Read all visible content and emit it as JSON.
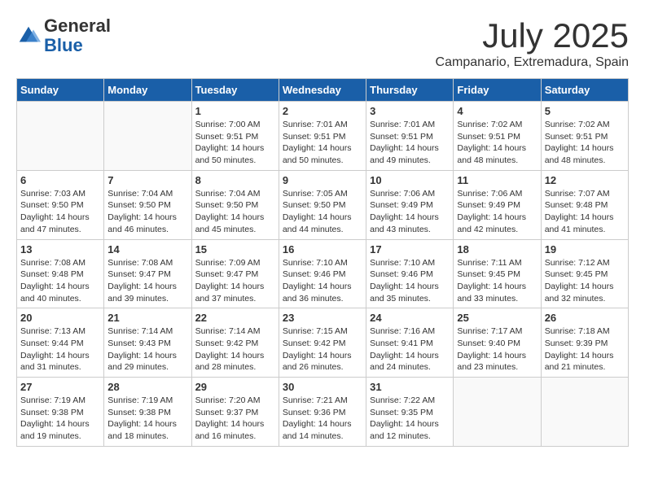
{
  "logo": {
    "general": "General",
    "blue": "Blue"
  },
  "header": {
    "month": "July 2025",
    "location": "Campanario, Extremadura, Spain"
  },
  "days_of_week": [
    "Sunday",
    "Monday",
    "Tuesday",
    "Wednesday",
    "Thursday",
    "Friday",
    "Saturday"
  ],
  "weeks": [
    [
      {
        "day": "",
        "info": ""
      },
      {
        "day": "",
        "info": ""
      },
      {
        "day": "1",
        "info": "Sunrise: 7:00 AM\nSunset: 9:51 PM\nDaylight: 14 hours and 50 minutes."
      },
      {
        "day": "2",
        "info": "Sunrise: 7:01 AM\nSunset: 9:51 PM\nDaylight: 14 hours and 50 minutes."
      },
      {
        "day": "3",
        "info": "Sunrise: 7:01 AM\nSunset: 9:51 PM\nDaylight: 14 hours and 49 minutes."
      },
      {
        "day": "4",
        "info": "Sunrise: 7:02 AM\nSunset: 9:51 PM\nDaylight: 14 hours and 48 minutes."
      },
      {
        "day": "5",
        "info": "Sunrise: 7:02 AM\nSunset: 9:51 PM\nDaylight: 14 hours and 48 minutes."
      }
    ],
    [
      {
        "day": "6",
        "info": "Sunrise: 7:03 AM\nSunset: 9:50 PM\nDaylight: 14 hours and 47 minutes."
      },
      {
        "day": "7",
        "info": "Sunrise: 7:04 AM\nSunset: 9:50 PM\nDaylight: 14 hours and 46 minutes."
      },
      {
        "day": "8",
        "info": "Sunrise: 7:04 AM\nSunset: 9:50 PM\nDaylight: 14 hours and 45 minutes."
      },
      {
        "day": "9",
        "info": "Sunrise: 7:05 AM\nSunset: 9:50 PM\nDaylight: 14 hours and 44 minutes."
      },
      {
        "day": "10",
        "info": "Sunrise: 7:06 AM\nSunset: 9:49 PM\nDaylight: 14 hours and 43 minutes."
      },
      {
        "day": "11",
        "info": "Sunrise: 7:06 AM\nSunset: 9:49 PM\nDaylight: 14 hours and 42 minutes."
      },
      {
        "day": "12",
        "info": "Sunrise: 7:07 AM\nSunset: 9:48 PM\nDaylight: 14 hours and 41 minutes."
      }
    ],
    [
      {
        "day": "13",
        "info": "Sunrise: 7:08 AM\nSunset: 9:48 PM\nDaylight: 14 hours and 40 minutes."
      },
      {
        "day": "14",
        "info": "Sunrise: 7:08 AM\nSunset: 9:47 PM\nDaylight: 14 hours and 39 minutes."
      },
      {
        "day": "15",
        "info": "Sunrise: 7:09 AM\nSunset: 9:47 PM\nDaylight: 14 hours and 37 minutes."
      },
      {
        "day": "16",
        "info": "Sunrise: 7:10 AM\nSunset: 9:46 PM\nDaylight: 14 hours and 36 minutes."
      },
      {
        "day": "17",
        "info": "Sunrise: 7:10 AM\nSunset: 9:46 PM\nDaylight: 14 hours and 35 minutes."
      },
      {
        "day": "18",
        "info": "Sunrise: 7:11 AM\nSunset: 9:45 PM\nDaylight: 14 hours and 33 minutes."
      },
      {
        "day": "19",
        "info": "Sunrise: 7:12 AM\nSunset: 9:45 PM\nDaylight: 14 hours and 32 minutes."
      }
    ],
    [
      {
        "day": "20",
        "info": "Sunrise: 7:13 AM\nSunset: 9:44 PM\nDaylight: 14 hours and 31 minutes."
      },
      {
        "day": "21",
        "info": "Sunrise: 7:14 AM\nSunset: 9:43 PM\nDaylight: 14 hours and 29 minutes."
      },
      {
        "day": "22",
        "info": "Sunrise: 7:14 AM\nSunset: 9:42 PM\nDaylight: 14 hours and 28 minutes."
      },
      {
        "day": "23",
        "info": "Sunrise: 7:15 AM\nSunset: 9:42 PM\nDaylight: 14 hours and 26 minutes."
      },
      {
        "day": "24",
        "info": "Sunrise: 7:16 AM\nSunset: 9:41 PM\nDaylight: 14 hours and 24 minutes."
      },
      {
        "day": "25",
        "info": "Sunrise: 7:17 AM\nSunset: 9:40 PM\nDaylight: 14 hours and 23 minutes."
      },
      {
        "day": "26",
        "info": "Sunrise: 7:18 AM\nSunset: 9:39 PM\nDaylight: 14 hours and 21 minutes."
      }
    ],
    [
      {
        "day": "27",
        "info": "Sunrise: 7:19 AM\nSunset: 9:38 PM\nDaylight: 14 hours and 19 minutes."
      },
      {
        "day": "28",
        "info": "Sunrise: 7:19 AM\nSunset: 9:38 PM\nDaylight: 14 hours and 18 minutes."
      },
      {
        "day": "29",
        "info": "Sunrise: 7:20 AM\nSunset: 9:37 PM\nDaylight: 14 hours and 16 minutes."
      },
      {
        "day": "30",
        "info": "Sunrise: 7:21 AM\nSunset: 9:36 PM\nDaylight: 14 hours and 14 minutes."
      },
      {
        "day": "31",
        "info": "Sunrise: 7:22 AM\nSunset: 9:35 PM\nDaylight: 14 hours and 12 minutes."
      },
      {
        "day": "",
        "info": ""
      },
      {
        "day": "",
        "info": ""
      }
    ]
  ]
}
